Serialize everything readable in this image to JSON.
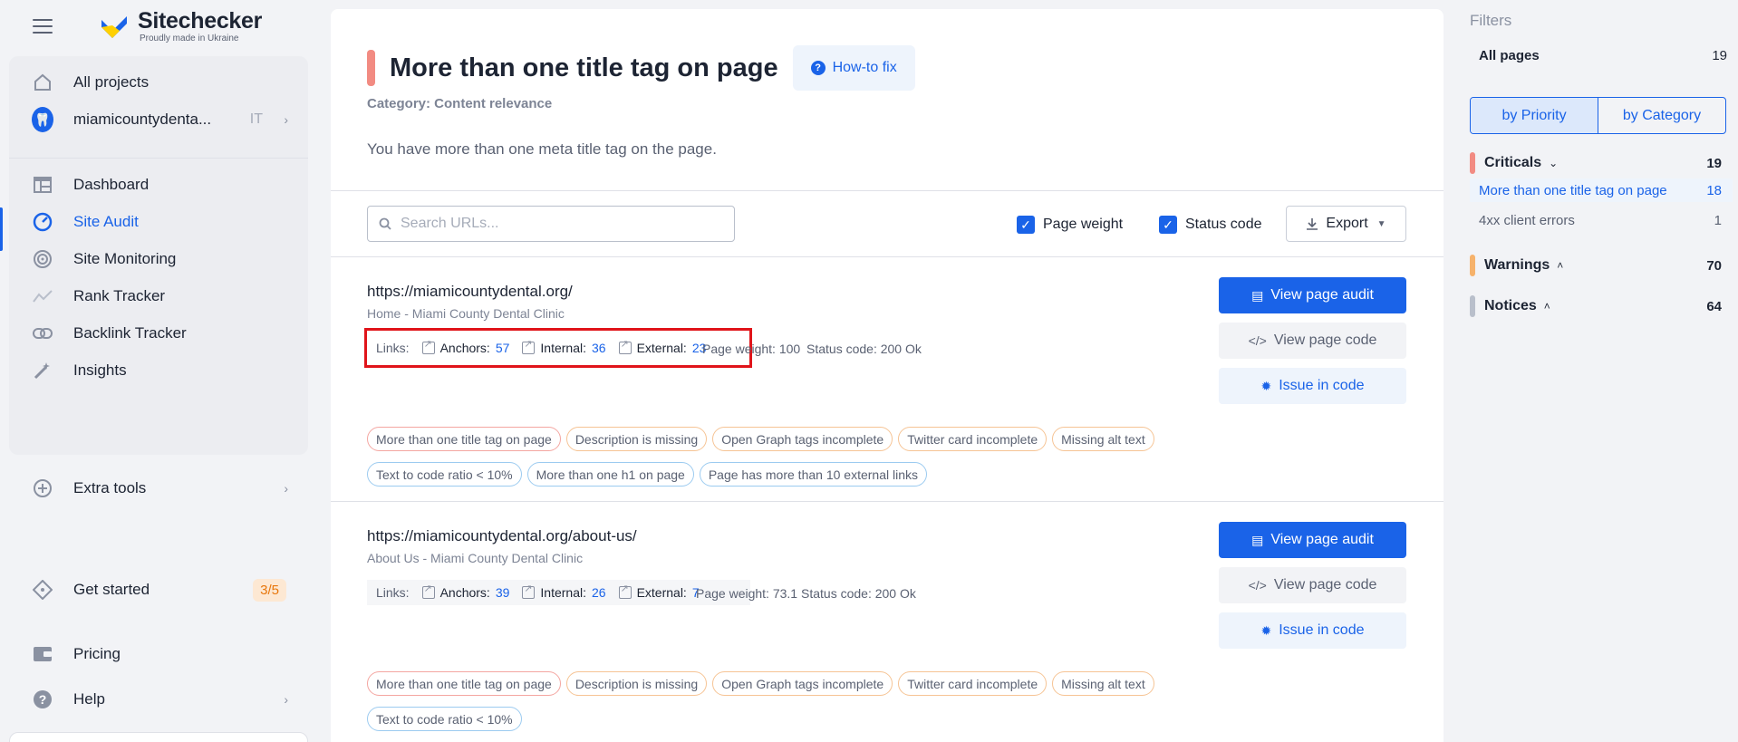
{
  "brand": {
    "name": "Sitechecker",
    "tagline": "Proudly made in Ukraine"
  },
  "sidebar": {
    "items": [
      {
        "label": "All projects",
        "icon": "home-icon"
      },
      {
        "label": "miamicountydenta...",
        "lang": "IT",
        "icon": "project-icon"
      },
      {
        "label": "Dashboard",
        "icon": "dashboard-icon"
      },
      {
        "label": "Site Audit",
        "icon": "gauge-icon"
      },
      {
        "label": "Site Monitoring",
        "icon": "radar-icon"
      },
      {
        "label": "Rank Tracker",
        "icon": "trend-icon"
      },
      {
        "label": "Backlink Tracker",
        "icon": "link-icon"
      },
      {
        "label": "Insights",
        "icon": "magic-wand-icon"
      }
    ],
    "extra_tools": "Extra tools",
    "get_started": "Get started",
    "get_started_badge": "3/5",
    "pricing": "Pricing",
    "help": "Help"
  },
  "issue": {
    "title": "More than one title tag on page",
    "howto": "How-to fix",
    "category": "Category: Content relevance",
    "description": "You have more than one meta title tag on the page."
  },
  "toolbar": {
    "search_placeholder": "Search URLs...",
    "page_weight_label": "Page weight",
    "status_code_label": "Status code",
    "export_label": "Export"
  },
  "rows": [
    {
      "url": "https://miamicountydental.org/",
      "title": "Home - Miami County Dental Clinic",
      "links_label": "Links:",
      "anchors_label": "Anchors:",
      "anchors": "57",
      "internal_label": "Internal:",
      "internal": "36",
      "external_label": "External:",
      "external": "23",
      "page_weight": "Page weight: 100",
      "status_code": "Status code: 200 Ok",
      "tags": [
        {
          "label": "More than one title tag on page",
          "kind": "red"
        },
        {
          "label": "Description is missing",
          "kind": "orange"
        },
        {
          "label": "Open Graph tags incomplete",
          "kind": "orange"
        },
        {
          "label": "Twitter card incomplete",
          "kind": "orange"
        },
        {
          "label": "Missing alt text",
          "kind": "orange"
        },
        {
          "label": "Text to code ratio < 10%",
          "kind": "blue"
        },
        {
          "label": "More than one h1 on page",
          "kind": "blue"
        },
        {
          "label": "Page has more than 10 external links",
          "kind": "blue"
        }
      ]
    },
    {
      "url": "https://miamicountydental.org/about-us/",
      "title": "About Us - Miami County Dental Clinic",
      "links_label": "Links:",
      "anchors_label": "Anchors:",
      "anchors": "39",
      "internal_label": "Internal:",
      "internal": "26",
      "external_label": "External:",
      "external": "7",
      "page_weight": "Page weight: 73.1",
      "status_code": "Status code: 200 Ok",
      "tags": [
        {
          "label": "More than one title tag on page",
          "kind": "red"
        },
        {
          "label": "Description is missing",
          "kind": "orange"
        },
        {
          "label": "Open Graph tags incomplete",
          "kind": "orange"
        },
        {
          "label": "Twitter card incomplete",
          "kind": "orange"
        },
        {
          "label": "Missing alt text",
          "kind": "orange"
        },
        {
          "label": "Text to code ratio < 10%",
          "kind": "blue"
        }
      ]
    }
  ],
  "buttons": {
    "view_audit": "View page audit",
    "view_code": "View page code",
    "issue_code": "Issue in code"
  },
  "filters": {
    "title": "Filters",
    "all_pages": "All pages",
    "all_pages_count": "19",
    "by_priority": "by Priority",
    "by_category": "by Category",
    "groups": [
      {
        "name": "Criticals",
        "count": "19",
        "color": "#f28b82",
        "caret": "⌄"
      },
      {
        "name": "Warnings",
        "count": "70",
        "color": "#f6b26b",
        "caret": "˄"
      },
      {
        "name": "Notices",
        "count": "64",
        "color": "#b9bfcb",
        "caret": "˄"
      }
    ],
    "critical_items": [
      {
        "label": "More than one title tag on page",
        "count": "18"
      },
      {
        "label": "4xx client errors",
        "count": "1"
      }
    ]
  },
  "colors": {
    "accent": "#1a63e8",
    "critical": "#f28b82",
    "warning": "#f6b26b",
    "highlight": "#e0141a"
  }
}
